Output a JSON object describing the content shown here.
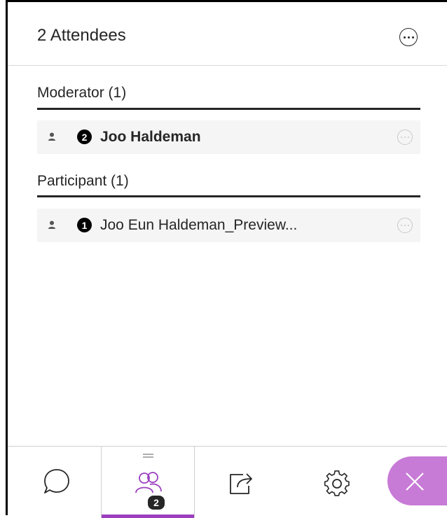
{
  "header": {
    "title": "2 Attendees",
    "more_icon": "more-options-icon"
  },
  "groups": [
    {
      "label": "Moderator (1)",
      "attendees": [
        {
          "number": "2",
          "name": "Joo Haldeman",
          "bold": true
        }
      ]
    },
    {
      "label": "Participant (1)",
      "attendees": [
        {
          "number": "1",
          "name": "Joo Eun Haldeman_Preview...",
          "bold": false
        }
      ]
    }
  ],
  "bottom_bar": {
    "tabs": [
      {
        "name": "chat",
        "icon": "chat-bubble-icon"
      },
      {
        "name": "attendees",
        "icon": "attendees-icon",
        "badge": "2",
        "selected": true
      },
      {
        "name": "share-content",
        "icon": "share-icon"
      },
      {
        "name": "settings",
        "icon": "gear-icon"
      }
    ],
    "close_icon": "close-icon"
  },
  "colors": {
    "accent": "#9b3fbf",
    "close_bg": "#c77ad6",
    "row_bg": "#f5f5f5",
    "text": "#262626"
  }
}
